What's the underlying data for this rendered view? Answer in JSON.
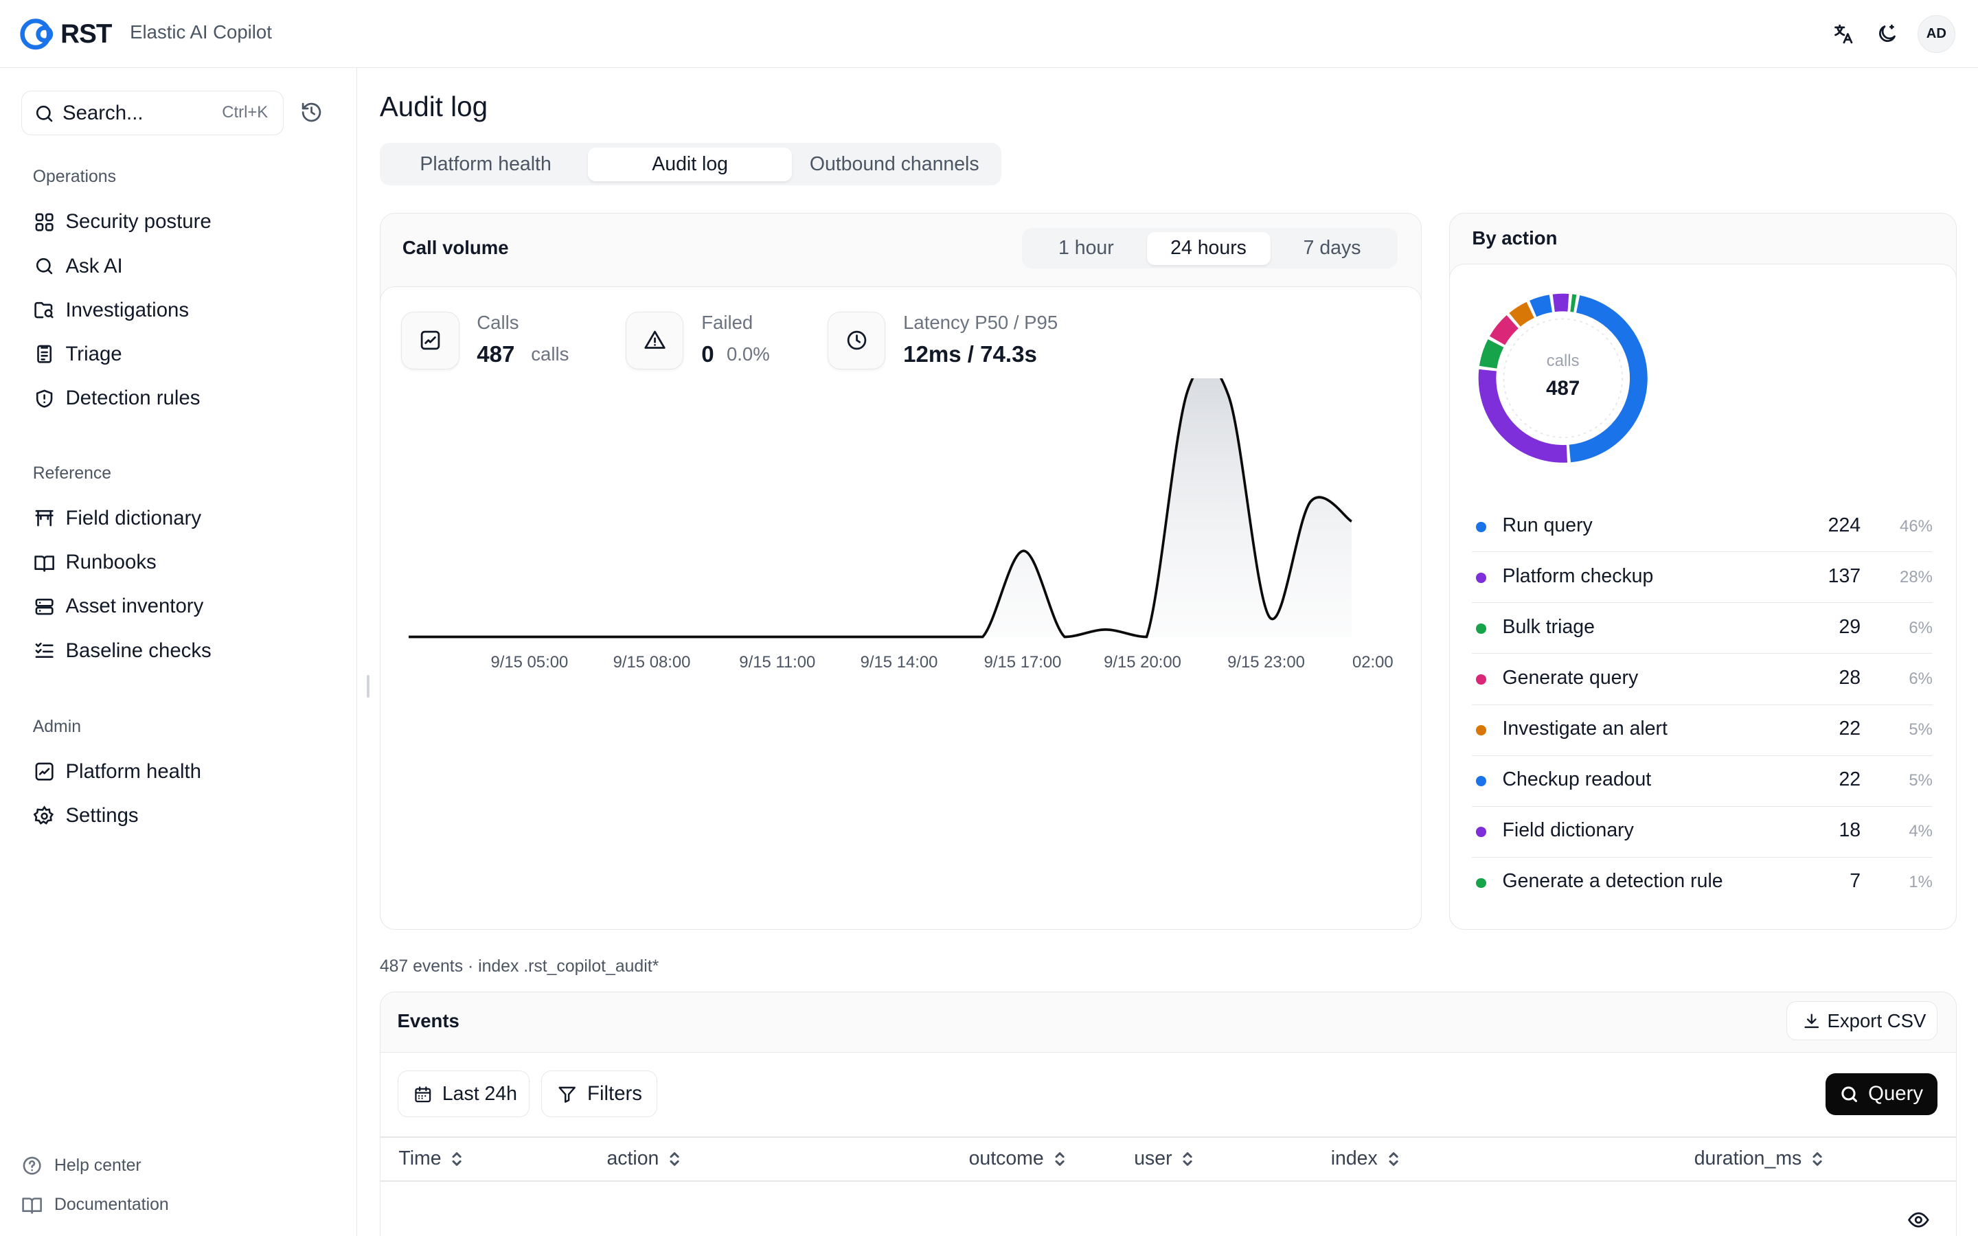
{
  "header": {
    "logo_text": "RST",
    "app_name": "Elastic AI Copilot",
    "avatar_initials": "AD",
    "icons": [
      "translate-icon",
      "theme-toggle-icon"
    ]
  },
  "sidebar": {
    "search": {
      "placeholder": "Search...",
      "shortcut": "Ctrl+K"
    },
    "sections": [
      {
        "title": "Operations",
        "items": [
          {
            "label": "Security posture",
            "icon": "grid-icon"
          },
          {
            "label": "Ask AI",
            "icon": "search-icon"
          },
          {
            "label": "Investigations",
            "icon": "folder-search-icon"
          },
          {
            "label": "Triage",
            "icon": "clipboard-icon"
          },
          {
            "label": "Detection rules",
            "icon": "shield-icon"
          }
        ]
      },
      {
        "title": "Reference",
        "items": [
          {
            "label": "Field dictionary",
            "icon": "table-icon"
          },
          {
            "label": "Runbooks",
            "icon": "book-icon"
          },
          {
            "label": "Asset inventory",
            "icon": "server-icon"
          },
          {
            "label": "Baseline checks",
            "icon": "checklist-icon"
          }
        ]
      },
      {
        "title": "Admin",
        "items": [
          {
            "label": "Platform health",
            "icon": "activity-icon"
          },
          {
            "label": "Settings",
            "icon": "gear-icon"
          }
        ]
      }
    ],
    "footer": [
      {
        "label": "Help center",
        "icon": "help-icon"
      },
      {
        "label": "Documentation",
        "icon": "book-icon"
      }
    ]
  },
  "main": {
    "title": "Audit log",
    "tabs": [
      {
        "label": "Platform health",
        "active": false
      },
      {
        "label": "Audit log",
        "active": true
      },
      {
        "label": "Outbound channels",
        "active": false
      }
    ],
    "call_volume": {
      "title": "Call volume",
      "ranges": [
        {
          "label": "1 hour",
          "active": false
        },
        {
          "label": "24 hours",
          "active": true
        },
        {
          "label": "7 days",
          "active": false
        }
      ],
      "stats": [
        {
          "label": "Calls",
          "value": "487",
          "sub": "calls",
          "icon": "activity-icon"
        },
        {
          "label": "Failed",
          "value": "0",
          "sub": "0.0%",
          "icon": "alert-triangle-icon"
        },
        {
          "label": "Latency P50 / P95",
          "value": "12ms / 74.3s",
          "sub": "",
          "icon": "clock-icon"
        }
      ]
    },
    "by_action": {
      "title": "By action",
      "donut_label": "calls",
      "donut_value": "487",
      "rows": [
        {
          "name": "Run query",
          "count": "224",
          "pct": "46%",
          "color": "#1a73e8"
        },
        {
          "name": "Platform checkup",
          "count": "137",
          "pct": "28%",
          "color": "#7e2fd9"
        },
        {
          "name": "Bulk triage",
          "count": "29",
          "pct": "6%",
          "color": "#16a34a"
        },
        {
          "name": "Generate query",
          "count": "28",
          "pct": "6%",
          "color": "#db2777"
        },
        {
          "name": "Investigate an alert",
          "count": "22",
          "pct": "5%",
          "color": "#d97706"
        },
        {
          "name": "Checkup readout",
          "count": "22",
          "pct": "5%",
          "color": "#1a73e8"
        },
        {
          "name": "Field dictionary",
          "count": "18",
          "pct": "4%",
          "color": "#7e2fd9"
        },
        {
          "name": "Generate a detection rule",
          "count": "7",
          "pct": "1%",
          "color": "#16a34a"
        }
      ]
    },
    "meta": "487 events · index .rst_copilot_audit*",
    "events": {
      "title": "Events",
      "export_label": "Export CSV",
      "time_filter": "Last 24h",
      "filters_label": "Filters",
      "query_label": "Query",
      "columns": [
        "Time",
        "action",
        "outcome",
        "user",
        "index",
        "duration_ms"
      ]
    }
  },
  "chart_data": [
    {
      "type": "area",
      "title": "Call volume",
      "x_ticks": [
        "9/15 05:00",
        "9/15 08:00",
        "9/15 11:00",
        "9/15 14:00",
        "9/15 17:00",
        "9/15 20:00",
        "9/15 23:00",
        "02:00"
      ],
      "x": [
        "9/15 03:00",
        "9/15 04:00",
        "9/15 05:00",
        "9/15 06:00",
        "9/15 07:00",
        "9/15 08:00",
        "9/15 09:00",
        "9/15 10:00",
        "9/15 11:00",
        "9/15 12:00",
        "9/15 13:00",
        "9/15 14:00",
        "9/15 15:00",
        "9/15 16:00",
        "9/15 17:00",
        "9/15 18:00",
        "9/15 19:00",
        "9/15 20:00",
        "9/15 21:00",
        "9/15 22:00",
        "9/15 23:00",
        "9/16 00:00",
        "9/16 01:00",
        "9/16 02:00",
        "9/16 03:00"
      ],
      "values": [
        0,
        0,
        0,
        0,
        0,
        0,
        0,
        0,
        0,
        0,
        0,
        0,
        0,
        0,
        0,
        35,
        0,
        3,
        0,
        100,
        98,
        8,
        55,
        47,
        47
      ],
      "ylabel": "",
      "xlabel": "",
      "ylim": [
        0,
        100
      ],
      "grid": false
    },
    {
      "type": "pie",
      "title": "By action",
      "categories": [
        "Run query",
        "Platform checkup",
        "Bulk triage",
        "Generate query",
        "Investigate an alert",
        "Checkup readout",
        "Field dictionary",
        "Generate a detection rule"
      ],
      "values": [
        224,
        137,
        29,
        28,
        22,
        22,
        18,
        7
      ],
      "colors": [
        "#1a73e8",
        "#7e2fd9",
        "#16a34a",
        "#db2777",
        "#d97706",
        "#1a73e8",
        "#7e2fd9",
        "#16a34a"
      ],
      "donut": true
    }
  ]
}
